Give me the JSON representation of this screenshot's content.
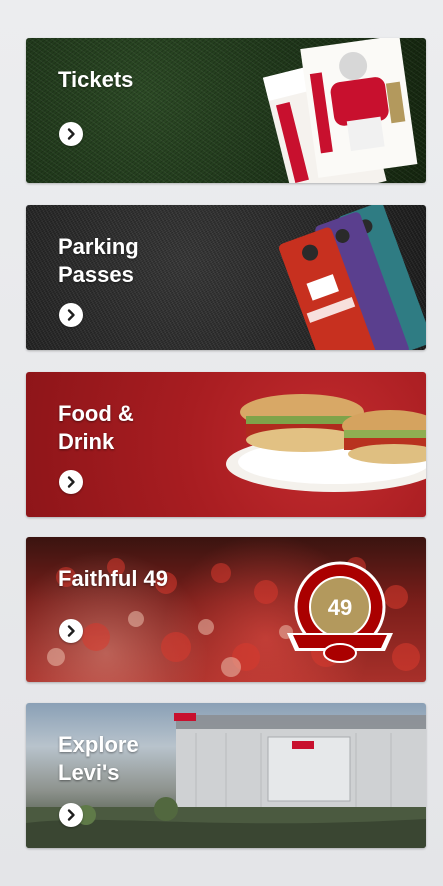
{
  "cards": [
    {
      "title": "Tickets",
      "arrow_icon": "chevron-right-icon"
    },
    {
      "title": "Parking\nPasses",
      "arrow_icon": "chevron-right-icon"
    },
    {
      "title": "Food &\nDrink",
      "arrow_icon": "chevron-right-icon"
    },
    {
      "title": "Faithful 49",
      "arrow_icon": "chevron-right-icon",
      "badge_number": "49"
    },
    {
      "title": "Explore\nLevi's",
      "arrow_icon": "chevron-right-icon"
    }
  ],
  "colors": {
    "page_bg": "#e7e8ea",
    "niners_red": "#aa0000",
    "niners_gold": "#b3995d",
    "button_bg": "#ffffff",
    "button_icon": "#1e1e1e"
  }
}
